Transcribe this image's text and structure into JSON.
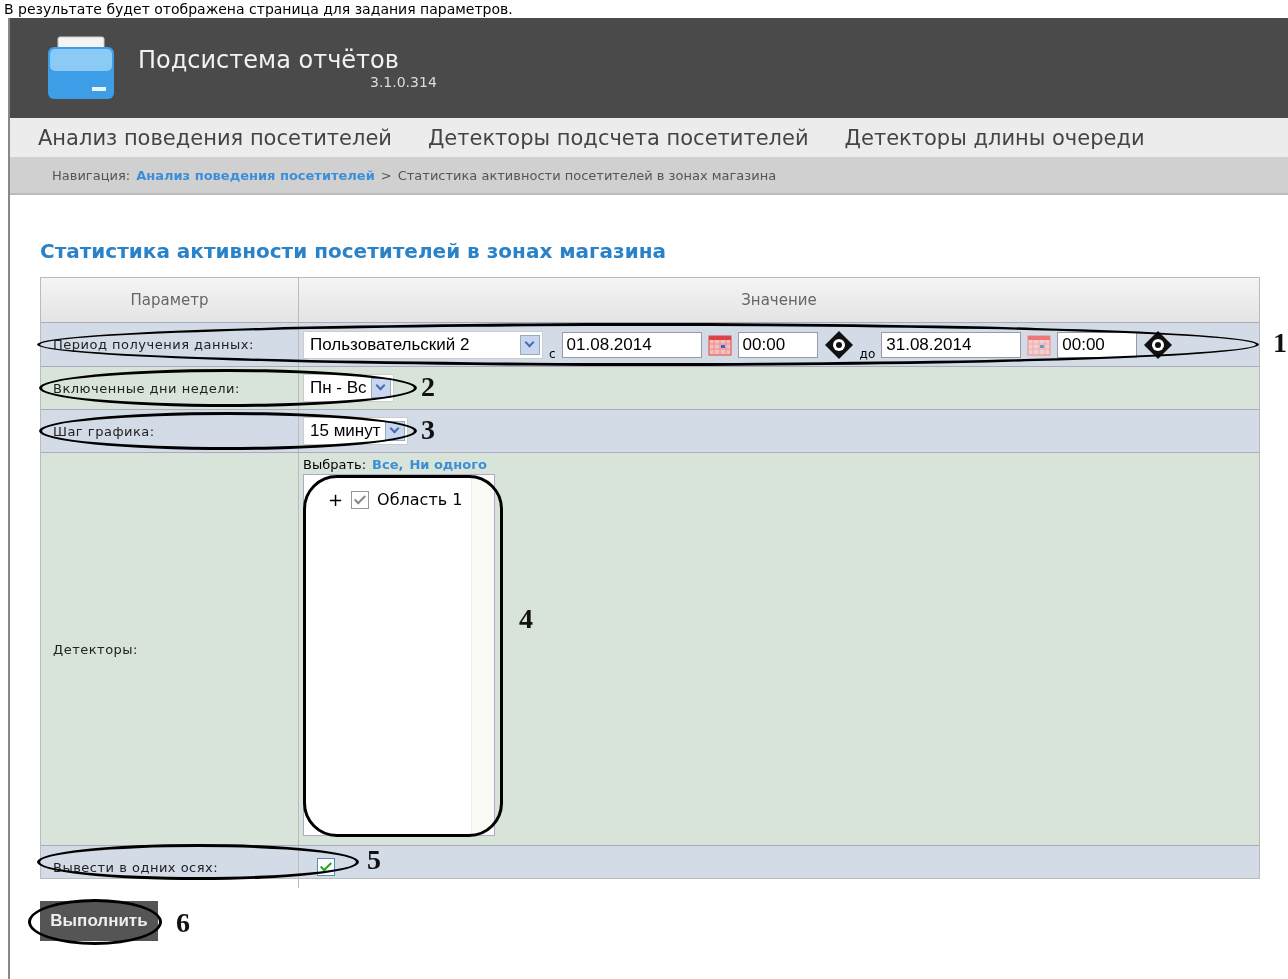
{
  "caption": "В результате будет отображена страница для задания параметров.",
  "app": {
    "title": "Подсистема отчётов",
    "version": "3.1.0.314"
  },
  "menu": [
    {
      "label": "Анализ поведения посетителей"
    },
    {
      "label": "Детекторы подсчета посетителей"
    },
    {
      "label": "Детекторы длины очереди"
    }
  ],
  "breadcrumb": {
    "label": "Навигация:",
    "link": "Анализ поведения посетителей",
    "separator": ">",
    "current": "Статистика активности посетителей в зонах магазина"
  },
  "page_title": "Статистика активности посетителей в зонах магазина",
  "table": {
    "columns": [
      "Параметр",
      "Значение"
    ],
    "rows": [
      {
        "kind": "period",
        "label": "Период получения данных:",
        "callout": "1",
        "preset": "Пользовательский 2",
        "from_label": "с",
        "from_date": "01.08.2014",
        "from_time": "00:00",
        "to_label": "до",
        "to_date": "31.08.2014",
        "to_time": "00:00"
      },
      {
        "kind": "select",
        "label": "Включенные дни недели:",
        "callout": "2",
        "value": "Пн - Вс"
      },
      {
        "kind": "select",
        "label": "Шаг графика:",
        "callout": "3",
        "value": "15 минут"
      },
      {
        "kind": "tree",
        "label": "Детекторы:",
        "callout": "4",
        "select_label": "Выбрать:",
        "select_all": "Все,",
        "select_none": "Ни одного",
        "items": [
          {
            "label": "Область 1",
            "expander": "+",
            "checked": true
          }
        ]
      },
      {
        "kind": "checkbox",
        "label": "Вывести в одних осях:",
        "callout": "5",
        "checked": true
      }
    ]
  },
  "run_button": {
    "label": "Выполнить",
    "callout": "6"
  }
}
